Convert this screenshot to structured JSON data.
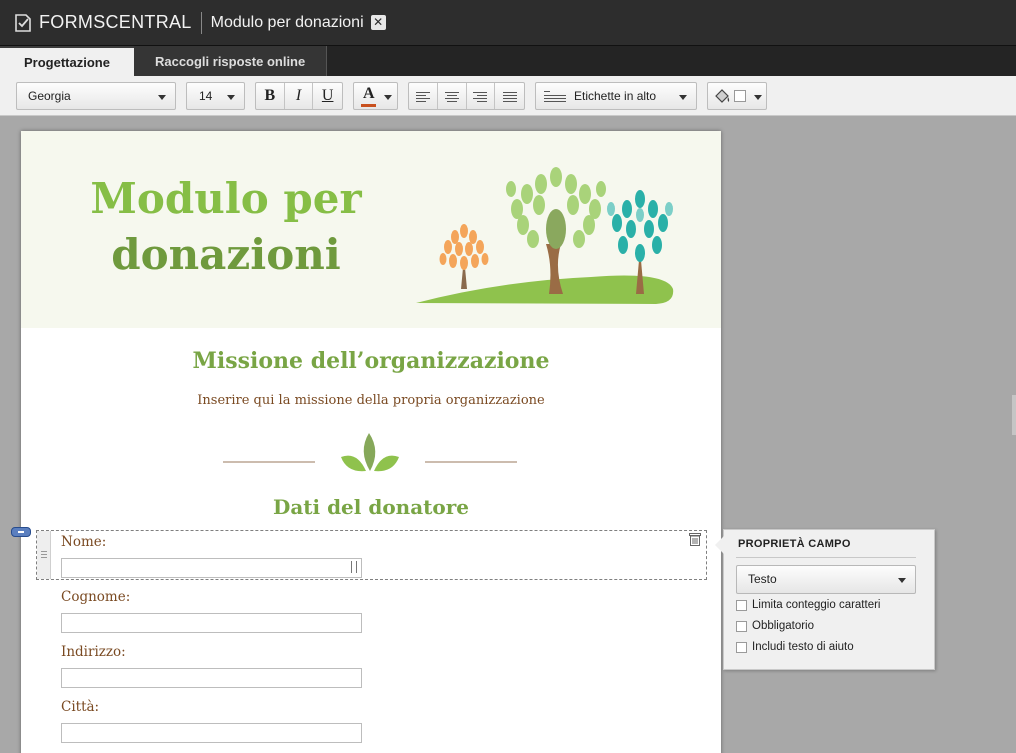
{
  "app": {
    "brand": "FORMSCENTRAL",
    "document_title": "Modulo per donazioni",
    "close_glyph": "✕"
  },
  "tabs": [
    {
      "label": "Progettazione",
      "active": true
    },
    {
      "label": "Raccogli risposte online",
      "active": false
    }
  ],
  "toolbar": {
    "font_family": "Georgia",
    "font_size": "14",
    "bold": "B",
    "italic": "I",
    "underline": "U",
    "text_color_glyph": "A",
    "text_color": "#c8501e",
    "label_position": "Etichette in alto",
    "icons": [
      "align-left-icon",
      "align-center-icon",
      "align-right-icon",
      "align-justify-icon",
      "paint-bucket-icon"
    ]
  },
  "form": {
    "header_title_line1": "Modulo per",
    "header_title_line2": "donazioni",
    "mission_title": "Missione dell’organizzazione",
    "mission_text": "Inserire qui la missione della propria organizzazione",
    "donor_title": "Dati del donatore",
    "fields": [
      {
        "label": "Nome:",
        "value": "",
        "selected": true
      },
      {
        "label": "Cognome:",
        "value": ""
      },
      {
        "label": "Indirizzo:",
        "value": ""
      },
      {
        "label": "Città:",
        "value": ""
      }
    ]
  },
  "properties": {
    "title": "PROPRIETÀ CAMPO",
    "type": "Testo",
    "options": [
      {
        "label": "Limita conteggio caratteri",
        "checked": false
      },
      {
        "label": "Obbligatorio",
        "checked": false
      },
      {
        "label": "Includi testo di aiuto",
        "checked": false
      }
    ]
  },
  "colors": {
    "title_bar": "#2d2d2d",
    "canvas": "#a8a8a8",
    "accent_green": "#86be46",
    "label_brown": "#7a4a22"
  }
}
